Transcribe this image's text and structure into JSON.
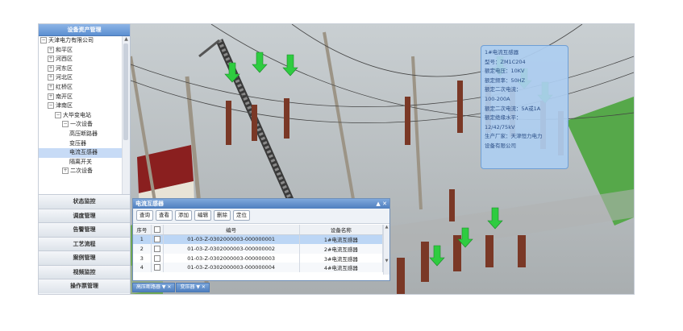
{
  "sidebar": {
    "header": "设备资产管理",
    "tree": [
      {
        "label": "天津电力有限公司",
        "level": 0,
        "exp": "⊟"
      },
      {
        "label": "和平区",
        "level": 1,
        "exp": "⊞"
      },
      {
        "label": "河西区",
        "level": 1,
        "exp": "⊞"
      },
      {
        "label": "河东区",
        "level": 1,
        "exp": "⊞"
      },
      {
        "label": "河北区",
        "level": 1,
        "exp": "⊞"
      },
      {
        "label": "红桥区",
        "level": 1,
        "exp": "⊞"
      },
      {
        "label": "南开区",
        "level": 1,
        "exp": "⊞"
      },
      {
        "label": "津南区",
        "level": 1,
        "exp": "⊟"
      },
      {
        "label": "大毕变电站",
        "level": 2,
        "exp": "⊟"
      },
      {
        "label": "一次设备",
        "level": 3,
        "exp": "⊟"
      },
      {
        "label": "高压断路器",
        "level": 4,
        "exp": ""
      },
      {
        "label": "变压器",
        "level": 4,
        "exp": ""
      },
      {
        "label": "电流互感器",
        "level": 4,
        "exp": "",
        "selected": true
      },
      {
        "label": "隔离开关",
        "level": 4,
        "exp": ""
      },
      {
        "label": "二次设备",
        "level": 3,
        "exp": "⊞"
      }
    ],
    "nav": [
      "状态监控",
      "调度管理",
      "告警管理",
      "工艺流程",
      "案例管理",
      "视频监控",
      "操作票管理"
    ]
  },
  "tooltip": {
    "lines": [
      "1#电流互感器",
      "型号：ZM1C204",
      "额定电压：10KV",
      "额定频率：50HZ",
      "额定二次电流：",
      "100-200A",
      "额定二次电流：5A或1A",
      "额定绝缘水平：",
      "12/42/75kV",
      "生产厂家：天津恒力电力",
      "设备有限公司"
    ]
  },
  "panel": {
    "title": "电流互感器",
    "controls": "▲ ✕",
    "buttons": [
      "查询",
      "查看",
      "添加",
      "编辑",
      "删除",
      "定位"
    ],
    "columns": [
      "序号",
      "",
      "编号",
      "设备名称"
    ],
    "rows": [
      {
        "idx": "1",
        "code": "01-03-Z-0302000003-000000001",
        "name": "1#电流互感器",
        "selected": true
      },
      {
        "idx": "2",
        "code": "01-03-Z-0302000003-000000002",
        "name": "2#电流互感器"
      },
      {
        "idx": "3",
        "code": "01-03-Z-0302000003-000000003",
        "name": "3#电流互感器"
      },
      {
        "idx": "4",
        "code": "01-03-Z-0302000003-000000004",
        "name": "4#电流互感器"
      }
    ]
  },
  "tabs": [
    "高压断路器 ▼ ✕",
    "变压器 ▼ ✕"
  ],
  "colors": {
    "accent": "#5b8fd1",
    "arrow": "#2ecc40",
    "tooltip_bg": "#adcef0"
  }
}
